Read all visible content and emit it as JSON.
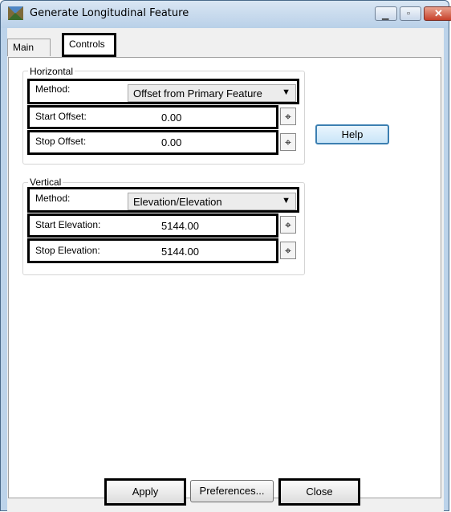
{
  "window": {
    "title": "Generate Longitudinal Feature"
  },
  "tabs": [
    {
      "label": "Main"
    },
    {
      "label": "Controls"
    }
  ],
  "horizontal": {
    "legend": "Horizontal",
    "method_label": "Method:",
    "method_value": "Offset from Primary Feature",
    "start_label": "Start Offset:",
    "start_value": "0.00",
    "stop_label": "Stop Offset:",
    "stop_value": "0.00"
  },
  "vertical": {
    "legend": "Vertical",
    "method_label": "Method:",
    "method_value": "Elevation/Elevation",
    "start_label": "Start Elevation:",
    "start_value": "5144.00",
    "stop_label": "Stop Elevation:",
    "stop_value": "5144.00"
  },
  "buttons": {
    "help": "Help",
    "apply": "Apply",
    "preferences": "Preferences...",
    "close": "Close"
  },
  "icons": {
    "app": "survey-feature-icon",
    "pick": "crosshair-icon",
    "dropdown": "chevron-down-icon"
  }
}
